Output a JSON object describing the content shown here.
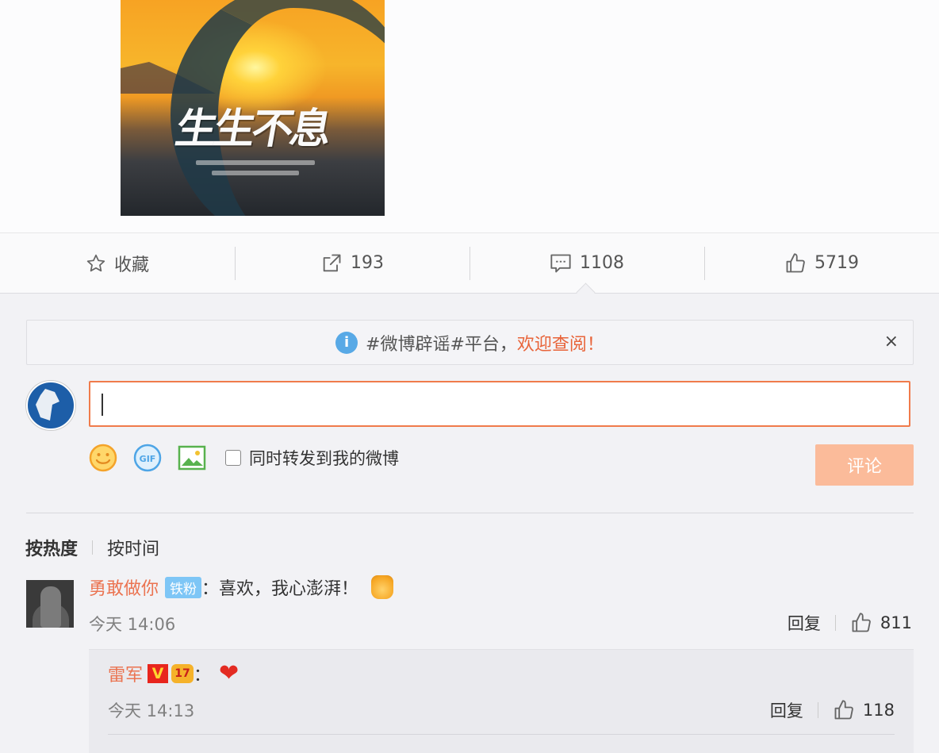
{
  "post_image": {
    "title": "生生不息"
  },
  "action_bar": {
    "favorite_label": "收藏",
    "repost_count": "193",
    "comment_count": "1108",
    "like_count": "5719"
  },
  "notice": {
    "text": "#微博辟谣#平台，",
    "link_text": "欢迎查阅！",
    "close_label": "×",
    "info_glyph": "i"
  },
  "composer": {
    "input_value": "",
    "repost_label": "同时转发到我的微博",
    "submit_label": "评论",
    "icons": [
      "emoji-icon",
      "gif-icon",
      "image-icon"
    ]
  },
  "sort": {
    "hot_label": "按热度",
    "time_label": "按时间"
  },
  "comments": [
    {
      "user": "勇敢做你",
      "badge": "铁粉",
      "text": "：喜欢，我心澎湃！",
      "time": "今天 14:06",
      "reply_label": "回复",
      "likes": "811",
      "replies": [
        {
          "user": "雷军",
          "v_badge": "V",
          "crown_badge": "17",
          "text": "：",
          "time": "今天 14:13",
          "reply_label": "回复",
          "likes": "118"
        }
      ]
    }
  ],
  "colors": {
    "accent": "#eb7350",
    "input_border": "#f07b4b",
    "submit_disabled": "#fbbb9a",
    "info_blue": "#58a9e6",
    "badge_blue": "#7ec6f6"
  }
}
